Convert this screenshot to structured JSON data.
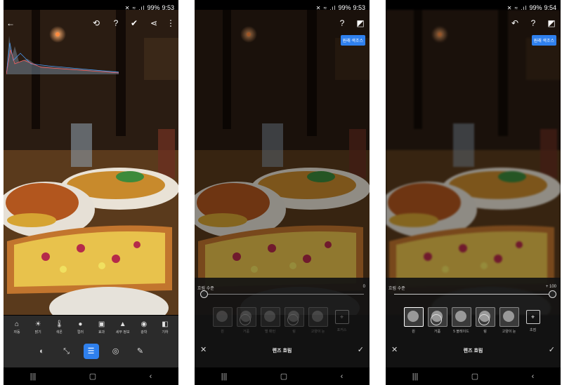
{
  "status": {
    "p1": {
      "battery": "99%",
      "time": "9:53"
    },
    "p2": {
      "battery": "99%",
      "time": "9:53"
    },
    "p3": {
      "battery": "99%",
      "time": "9:54"
    }
  },
  "badge_label": "원래 색조스",
  "panel1": {
    "tools": [
      {
        "label": "자동",
        "icon": "auto-icon"
      },
      {
        "label": "밝기",
        "icon": "brightness-icon"
      },
      {
        "label": "색온",
        "icon": "temperature-icon"
      },
      {
        "label": "컬러",
        "icon": "color-drop-icon"
      },
      {
        "label": "효과",
        "icon": "effects-icon"
      },
      {
        "label": "세부 정보",
        "icon": "detail-icon"
      },
      {
        "label": "광학",
        "icon": "optics-icon"
      },
      {
        "label": "기하",
        "icon": "geometry-icon"
      }
    ],
    "modes": [
      {
        "icon": "presets-icon",
        "glyph": "◐"
      },
      {
        "icon": "crop-icon",
        "glyph": "⤡"
      },
      {
        "icon": "sliders-icon",
        "glyph": "☰"
      },
      {
        "icon": "selective-icon",
        "glyph": "◎"
      },
      {
        "icon": "heal-icon",
        "glyph": "✎"
      }
    ]
  },
  "panel2": {
    "slider_label": "흐림 수준",
    "slider_value": "0",
    "slider_fraction": 0.0,
    "presets": [
      "원",
      "거품",
      "별 패턴",
      "링",
      "고양이 눈"
    ],
    "focus_label": "포커스",
    "title": "렌즈 흐림"
  },
  "panel3": {
    "slider_label": "흐림 수준",
    "slider_value": "+ 100",
    "slider_fraction": 1.0,
    "presets": [
      "원",
      "거품",
      "5 블레이드",
      "링",
      "고양이 눈"
    ],
    "focus_label": "초점",
    "title": "렌즈 흐림"
  },
  "navbar": {
    "recent": "|||",
    "home": "▢",
    "back": "‹"
  },
  "colors": {
    "accent": "#2f80ed",
    "panel_bg": "#2b2b2b"
  }
}
